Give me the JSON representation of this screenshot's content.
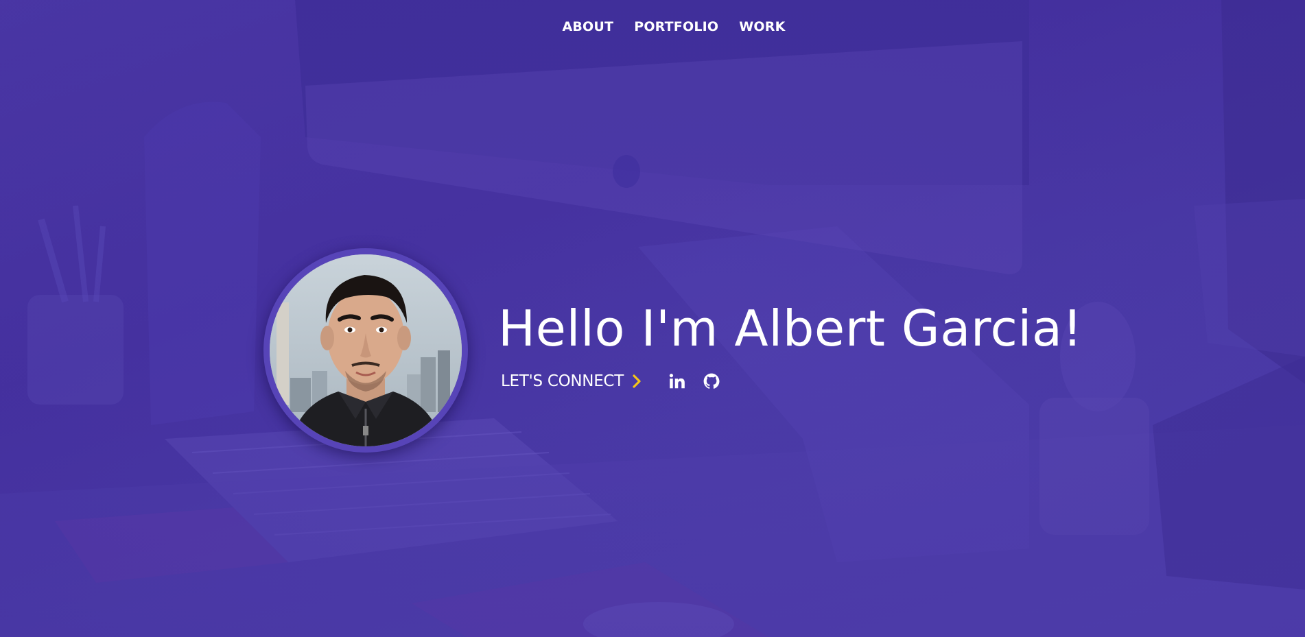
{
  "nav": {
    "items": [
      {
        "label": "ABOUT"
      },
      {
        "label": "PORTFOLIO"
      },
      {
        "label": "WORK"
      }
    ]
  },
  "hero": {
    "title": "Hello I'm Albert Garcia!",
    "connect_label": "LET'S CONNECT",
    "social": [
      {
        "icon": "linkedin-icon"
      },
      {
        "icon": "github-icon"
      }
    ]
  },
  "colors": {
    "background": "#4a3aa4",
    "accent": "#f5c518",
    "text": "#ffffff"
  }
}
